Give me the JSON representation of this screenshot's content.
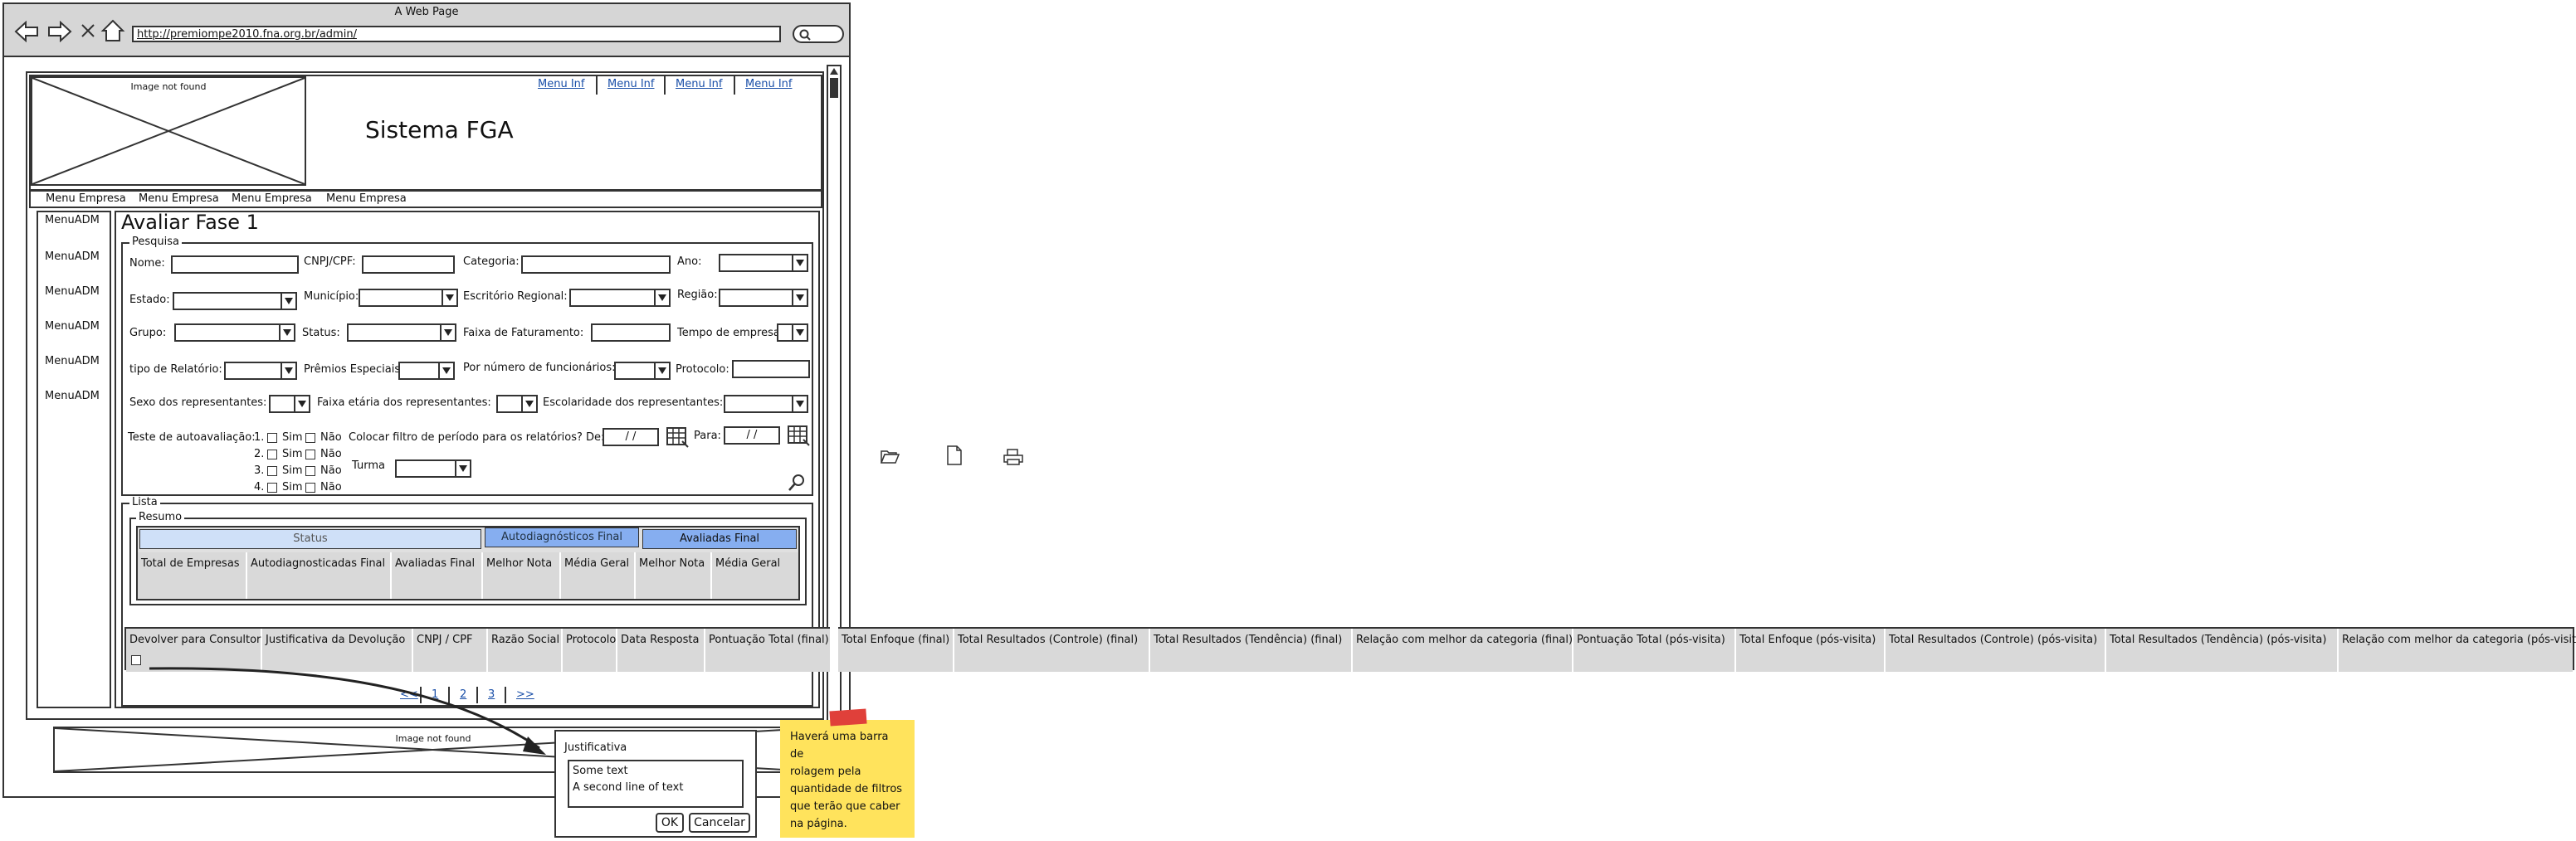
{
  "browser": {
    "window_title": "A Web Page",
    "url": "http://premiompe2010.fna.org.br/admin/"
  },
  "header": {
    "logo_placeholder": "Image not found",
    "title": "Sistema FGA",
    "top_menu": [
      "Menu Inf",
      "Menu Inf",
      "Menu Inf",
      "Menu Inf"
    ]
  },
  "company_menu": [
    "Menu Empresa",
    "Menu Empresa",
    "Menu Empresa",
    "Menu Empresa"
  ],
  "sidebar": {
    "items": [
      "MenuADM",
      "MenuADM",
      "MenuADM",
      "MenuADM",
      "MenuADM",
      "MenuADM"
    ]
  },
  "page": {
    "title": "Avaliar Fase 1"
  },
  "search": {
    "group_label": "Pesquisa",
    "labels": {
      "nome": "Nome:",
      "cnpj": "CNPJ/CPF:",
      "categoria": "Categoria:",
      "ano": "Ano:",
      "estado": "Estado:",
      "municipio": "Município:",
      "escritorio": "Escritório Regional:",
      "regiao": "Região:",
      "grupo": "Grupo:",
      "status": "Status:",
      "faixa_faturamento": "Faixa de Faturamento:",
      "tempo_empresa": "Tempo de empresa:",
      "tipo_relatorio": "tipo de Relatório:",
      "premios": "Prêmios Especiais:",
      "funcionarios": "Por número de funcionários:",
      "protocolo": "Protocolo:",
      "sexo": "Sexo dos representantes:",
      "faixa_etaria": "Faixa etária dos representantes:",
      "escolaridade": "Escolaridade dos representantes:",
      "teste": "Teste de autoavaliação:",
      "periodo": "Colocar filtro de período para os relatórios? De:",
      "para": "Para:",
      "turma": "Turma"
    },
    "self_eval_rows": [
      "1.",
      "2.",
      "3.",
      "4."
    ],
    "option_sim": "Sim",
    "option_nao": "Não",
    "date_from": "/ /",
    "date_to": "/ /"
  },
  "lista": {
    "group_label": "Lista",
    "resumo_label": "Resumo",
    "resumo_headers": [
      "Status",
      "Autodiagnósticos Final",
      "Avaliadas Final"
    ],
    "resumo_columns": [
      "Total de Empresas",
      "Autodiagnosticadas Final",
      "Avaliadas Final",
      "Melhor Nota",
      "Média Geral",
      "Melhor Nota",
      "Média Geral"
    ],
    "main_columns": [
      "Devolver para Consultor",
      "Justificativa da Devolução",
      "CNPJ / CPF",
      "Razão Social",
      "Protocolo",
      "Data Resposta",
      "Pontuação Total (final)",
      "Total Enfoque (final)",
      "Total Resultados (Controle) (final)",
      "Total Resultados (Tendência) (final)",
      "Relação com melhor da categoria (final)",
      "Pontuação Total (pós-visita)",
      "Total Enfoque (pós-visita)",
      "Total Resultados (Controle) (pós-visita)",
      "Total Resultados (Tendência) (pós-visita)",
      "Relação com melhor da categoria (pós-visita)"
    ]
  },
  "pagination": [
    "<<",
    "1",
    "2",
    "3",
    ">>"
  ],
  "footer": {
    "image_placeholder": "Image not found"
  },
  "dialog": {
    "title": "Justificativa",
    "text_line1": "Some text",
    "text_line2": "A second line of text",
    "ok": "OK",
    "cancel": "Cancelar"
  },
  "sticky_note": {
    "lines": [
      "Haverá uma barra de",
      "rolagem pela",
      "quantidade de filtros",
      "que terão que caber",
      "na página."
    ],
    "color": "#ffe35c"
  },
  "colors": {
    "resumo_status_bg": "#cfe0f8",
    "resumo_accent_bg": "#86aef0",
    "browser_chrome": "#d6d6d6",
    "link": "#1a4fa8"
  }
}
